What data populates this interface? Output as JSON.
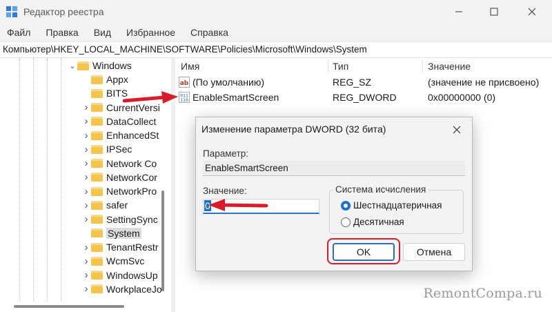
{
  "window": {
    "title": "Редактор реестра"
  },
  "menu": [
    "Файл",
    "Правка",
    "Вид",
    "Избранное",
    "Справка"
  ],
  "address": "Компьютер\\HKEY_LOCAL_MACHINE\\SOFTWARE\\Policies\\Microsoft\\Windows\\System",
  "tree": {
    "parent": "Windows",
    "children": [
      {
        "label": "Appx",
        "expandable": false
      },
      {
        "label": "BITS",
        "expandable": false
      },
      {
        "label": "CurrentVersi",
        "expandable": true
      },
      {
        "label": "DataCollect",
        "expandable": true
      },
      {
        "label": "EnhancedSt",
        "expandable": true
      },
      {
        "label": "IPSec",
        "expandable": true
      },
      {
        "label": "Network Co",
        "expandable": true
      },
      {
        "label": "NetworkCor",
        "expandable": true
      },
      {
        "label": "NetworkPro",
        "expandable": true
      },
      {
        "label": "safer",
        "expandable": true
      },
      {
        "label": "SettingSync",
        "expandable": true
      },
      {
        "label": "System",
        "expandable": false,
        "selected": true
      },
      {
        "label": "TenantRestr",
        "expandable": true
      },
      {
        "label": "WcmSvc",
        "expandable": true
      },
      {
        "label": "WindowsUp",
        "expandable": true
      },
      {
        "label": "WorkplaceJo",
        "expandable": true
      }
    ]
  },
  "values": {
    "columns": {
      "name": "Имя",
      "type": "Тип",
      "value": "Значение"
    },
    "rows": [
      {
        "icon": "reg-sz-icon",
        "name": "(По умолчанию)",
        "type": "REG_SZ",
        "value": "(значение не присвоено)"
      },
      {
        "icon": "reg-dword-icon",
        "name": "EnableSmartScreen",
        "type": "REG_DWORD",
        "value": "0x00000000 (0)"
      }
    ]
  },
  "dialog": {
    "title": "Изменение параметра DWORD (32 бита)",
    "param_label": "Параметр:",
    "param_value": "EnableSmartScreen",
    "value_label": "Значение:",
    "value": "0",
    "radix_label": "Система исчисления",
    "radix_options": [
      {
        "label": "Шестнадцатеричная",
        "checked": true
      },
      {
        "label": "Десятичная",
        "checked": false
      }
    ],
    "ok": "OK",
    "cancel": "Отмена"
  },
  "watermark": "RemontCompa.ru",
  "colors": {
    "accent": "#1f6fd1",
    "annotation": "#d81c2c",
    "folder": "#f4c54d"
  }
}
